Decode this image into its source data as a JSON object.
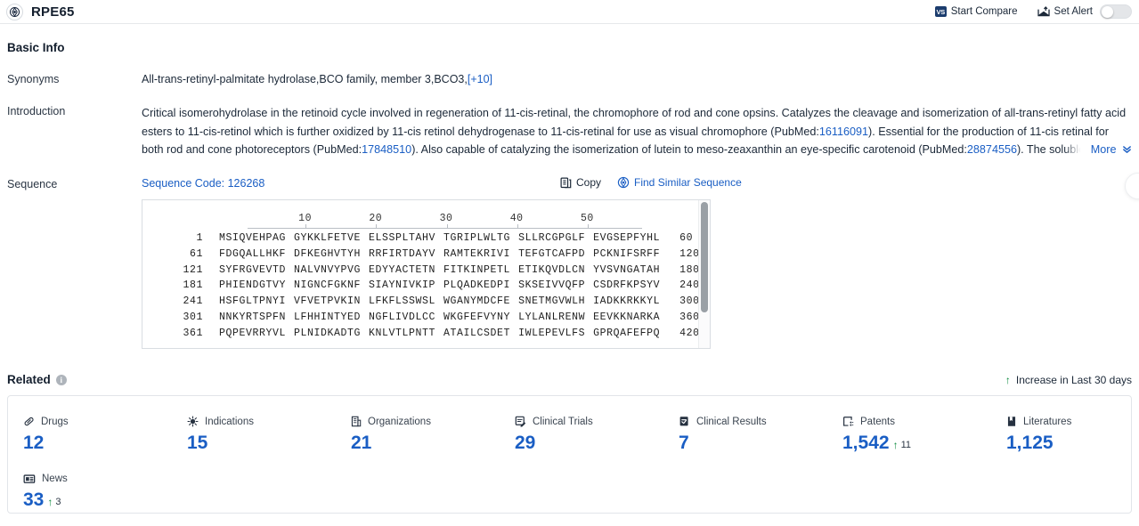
{
  "header": {
    "logo_icon": "target-icon",
    "title": "RPE65",
    "compare": {
      "label": "Start Compare",
      "icon": "vs-badge-icon",
      "badge_text": "VS"
    },
    "alert": {
      "label": "Set Alert",
      "icon": "alert-mail-icon",
      "toggle_on": false
    }
  },
  "basic_info": {
    "title": "Basic Info",
    "synonyms": {
      "label": "Synonyms",
      "text": "All-trans-retinyl-palmitate hydrolase,BCO family, member 3,BCO3,",
      "more_link": "[+10]"
    },
    "introduction": {
      "label": "Introduction",
      "part1": "Critical isomerohydrolase in the retinoid cycle involved in regeneration of 11-cis-retinal, the chromophore of rod and cone opsins. Catalyzes the cleavage and isomerization of all-trans-retinyl fatty acid esters to 11-cis-retinol which is further oxidized by 11-cis retinol dehydrogenase to 11-cis-retinal for use as visual chromophore (PubMed:",
      "pubmed1": "16116091",
      "part2": "). Essential for the production of 11-cis retinal for both rod and cone photoreceptors (PubMed:",
      "pubmed2": "17848510",
      "part3": "). Also capable of catalyzing the isomerization of lutein to meso-zeaxanthin an eye-specific carotenoid (PubMed:",
      "pubmed3": "28874556",
      "part4": "). The soluble form binds vitamin A (all-trans-retinol), making it available",
      "more_label": "More"
    }
  },
  "sequence": {
    "label": "Sequence",
    "code_label": "Sequence Code: 126268",
    "copy_label": "Copy",
    "copy_icon": "copy-icon",
    "similar_label": "Find Similar Sequence",
    "similar_icon": "find-similar-icon",
    "ruler_ticks": [
      "10",
      "20",
      "30",
      "40",
      "50"
    ],
    "rows": [
      {
        "start": "1",
        "chunks": [
          "MSIQVEHPAG",
          "GYKKLFETVE",
          "ELSSPLTAHV",
          "TGRIPLWLTG",
          "SLLRCGPGLF",
          "EVGSEPFYHL"
        ],
        "end": "60"
      },
      {
        "start": "61",
        "chunks": [
          "FDGQALLHKF",
          "DFKEGHVTYH",
          "RRFIRTDAYV",
          "RAMTEKRIVI",
          "TEFGTCAFPD",
          "PCKNIFSRFF"
        ],
        "end": "120"
      },
      {
        "start": "121",
        "chunks": [
          "SYFRGVEVTD",
          "NALVNVYPVG",
          "EDYYACTETN",
          "FITKINPETL",
          "ETIKQVDLCN",
          "YVSVNGATAH"
        ],
        "end": "180"
      },
      {
        "start": "181",
        "chunks": [
          "PHIENDGTVY",
          "NIGNCFGKNF",
          "SIAYNIVKIP",
          "PLQADKEDPI",
          "SKSEIVVQFP",
          "CSDRFKPSYV"
        ],
        "end": "240"
      },
      {
        "start": "241",
        "chunks": [
          "HSFGLTPNYI",
          "VFVETPVKIN",
          "LFKFLSSWSL",
          "WGANYMDCFE",
          "SNETMGVWLH",
          "IADKKRKKYL"
        ],
        "end": "300"
      },
      {
        "start": "301",
        "chunks": [
          "NNKYRTSPFN",
          "LFHHINTYED",
          "NGFLIVDLCC",
          "WKGFEFVYNY",
          "LYLANLRENW",
          "EEVKKNARKA"
        ],
        "end": "360"
      },
      {
        "start": "361",
        "chunks": [
          "PQPEVRRYVL",
          "PLNIDKADTG",
          "KNLVTLPNTT",
          "ATAILCSDET",
          "IWLEPEVLFS",
          "GPRQAFEFPQ"
        ],
        "end": "420"
      }
    ]
  },
  "related": {
    "title": "Related",
    "info_icon": "info-icon",
    "legend": {
      "icon": "up-arrow-icon",
      "label": "Increase in Last 30 days"
    },
    "stats": [
      {
        "label": "Drugs",
        "icon": "pill-icon",
        "value": "12",
        "delta": ""
      },
      {
        "label": "Indications",
        "icon": "virus-icon",
        "value": "15",
        "delta": ""
      },
      {
        "label": "Organizations",
        "icon": "building-icon",
        "value": "21",
        "delta": ""
      },
      {
        "label": "Clinical Trials",
        "icon": "clinical-trial-icon",
        "value": "29",
        "delta": ""
      },
      {
        "label": "Clinical Results",
        "icon": "clinical-result-icon",
        "value": "7",
        "delta": ""
      },
      {
        "label": "Patents",
        "icon": "patent-icon",
        "value": "1,542",
        "delta": "11"
      },
      {
        "label": "Literatures",
        "icon": "literature-icon",
        "value": "1,125",
        "delta": ""
      },
      {
        "label": "News",
        "icon": "news-icon",
        "value": "33",
        "delta": "3"
      }
    ]
  },
  "colors": {
    "accent": "#1a5ec4",
    "increase": "#0d8a3e",
    "brand_dark": "#1c3d6e"
  }
}
